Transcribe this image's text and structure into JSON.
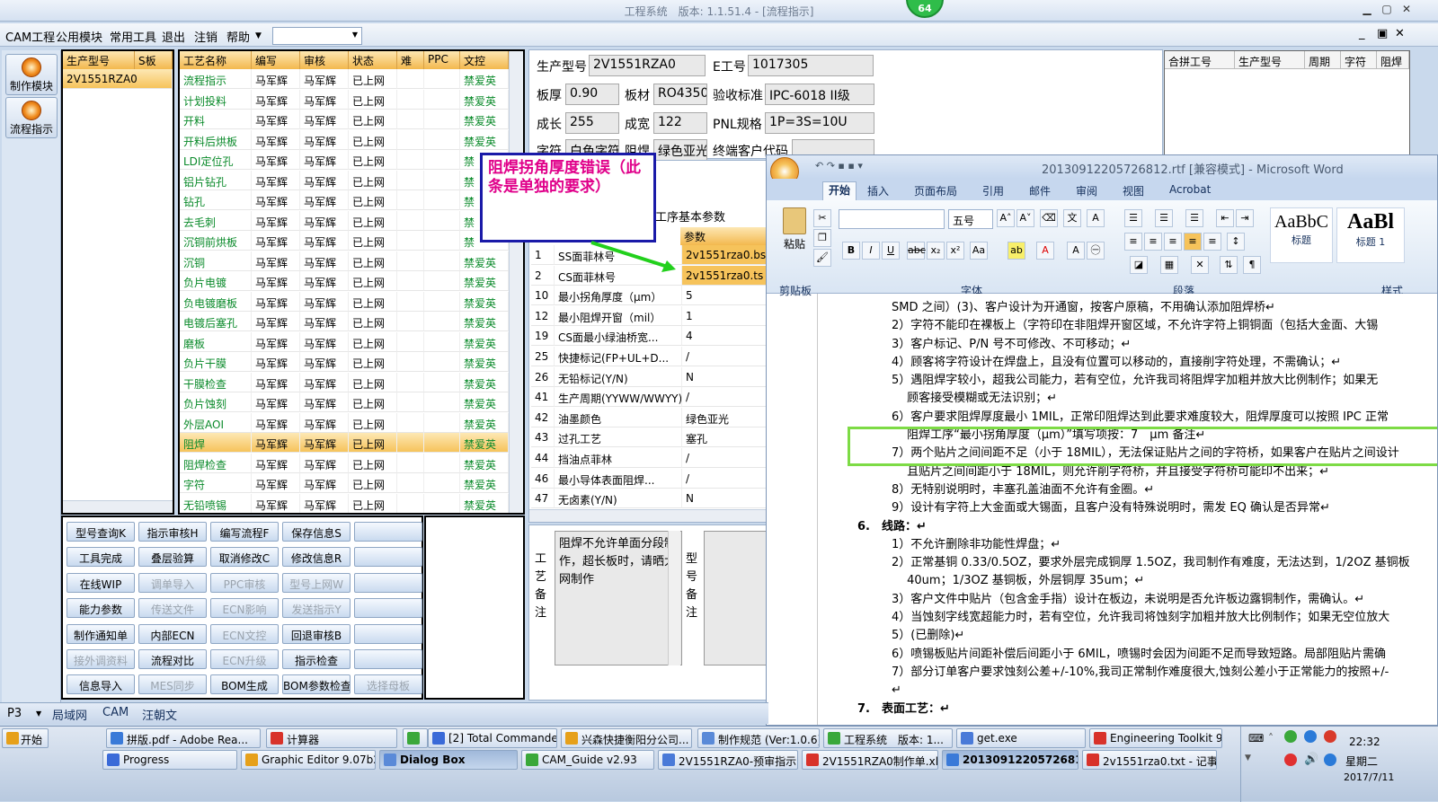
{
  "app": {
    "title": "工程系统　版本: 1.1.51.4 - [流程指示]",
    "badge": "64"
  },
  "menu": [
    "CAM工程",
    "公用模块",
    "常用工具",
    "退出",
    "注销",
    "帮助"
  ],
  "nav": [
    "制作模块",
    "流程指示"
  ],
  "model_list": {
    "headers": [
      "生产型号",
      "S板"
    ],
    "rows": [
      [
        "2V1551RZA0",
        ""
      ]
    ]
  },
  "process": {
    "headers": [
      "工艺名称",
      "编写",
      "审核",
      "状态",
      "难",
      "PPC",
      "文控"
    ],
    "rows": [
      [
        "流程指示",
        "马军辉",
        "马军辉",
        "已上网",
        "",
        "",
        "禁爱英"
      ],
      [
        "计划投料",
        "马军辉",
        "马军辉",
        "已上网",
        "",
        "",
        "禁爱英"
      ],
      [
        "开料",
        "马军辉",
        "马军辉",
        "已上网",
        "",
        "",
        "禁爱英"
      ],
      [
        "开料后烘板",
        "马军辉",
        "马军辉",
        "已上网",
        "",
        "",
        "禁爱英"
      ],
      [
        "LDI定位孔",
        "马军辉",
        "马军辉",
        "已上网",
        "",
        "",
        "禁"
      ],
      [
        "铝片钻孔",
        "马军辉",
        "马军辉",
        "已上网",
        "",
        "",
        "禁"
      ],
      [
        "钻孔",
        "马军辉",
        "马军辉",
        "已上网",
        "",
        "",
        "禁"
      ],
      [
        "去毛刺",
        "马军辉",
        "马军辉",
        "已上网",
        "",
        "",
        "禁"
      ],
      [
        "沉铜前烘板",
        "马军辉",
        "马军辉",
        "已上网",
        "",
        "",
        "禁"
      ],
      [
        "沉铜",
        "马军辉",
        "马军辉",
        "已上网",
        "",
        "",
        "禁爱英"
      ],
      [
        "负片电镀",
        "马军辉",
        "马军辉",
        "已上网",
        "",
        "",
        "禁爱英"
      ],
      [
        "负电镀磨板",
        "马军辉",
        "马军辉",
        "已上网",
        "",
        "",
        "禁爱英"
      ],
      [
        "电镀后塞孔",
        "马军辉",
        "马军辉",
        "已上网",
        "",
        "",
        "禁爱英"
      ],
      [
        "磨板",
        "马军辉",
        "马军辉",
        "已上网",
        "",
        "",
        "禁爱英"
      ],
      [
        "负片干膜",
        "马军辉",
        "马军辉",
        "已上网",
        "",
        "",
        "禁爱英"
      ],
      [
        "干膜检查",
        "马军辉",
        "马军辉",
        "已上网",
        "",
        "",
        "禁爱英"
      ],
      [
        "负片蚀刻",
        "马军辉",
        "马军辉",
        "已上网",
        "",
        "",
        "禁爱英"
      ],
      [
        "外层AOI",
        "马军辉",
        "马军辉",
        "已上网",
        "",
        "",
        "禁爱英"
      ],
      [
        "阻焊",
        "马军辉",
        "马军辉",
        "已上网",
        "",
        "",
        "禁爱英"
      ],
      [
        "阻焊检查",
        "马军辉",
        "马军辉",
        "已上网",
        "",
        "",
        "禁爱英"
      ],
      [
        "字符",
        "马军辉",
        "马军辉",
        "已上网",
        "",
        "",
        "禁爱英"
      ],
      [
        "无铅喷锡",
        "马军辉",
        "马军辉",
        "已上网",
        "",
        "",
        "禁爱英"
      ]
    ],
    "selected_index": 18
  },
  "buttons": [
    [
      "型号查询K",
      "指示审核H",
      "编写流程F",
      "保存信息S",
      ""
    ],
    [
      "工具完成",
      "叠层验算",
      "取消修改C",
      "修改信息R",
      ""
    ],
    [
      "在线WIP",
      "调单导入",
      "PPC审核",
      "型号上网W",
      ""
    ],
    [
      "能力参数",
      "传送文件",
      "ECN影响",
      "发送指示Y",
      ""
    ],
    [
      "制作通知单",
      "内部ECN",
      "ECN文控",
      "回退审核B",
      ""
    ],
    [
      "接外调资料",
      "流程对比",
      "ECN升级",
      "指示检查",
      ""
    ],
    [
      "信息导入",
      "MES同步",
      "BOM生成",
      "BOM参数检查",
      "选择母板"
    ]
  ],
  "disabled_buttons": [
    "调单导入",
    "PPC审核",
    "型号上网W",
    "传送文件",
    "ECN影响",
    "发送指示Y",
    "ECN文控",
    "接外调资料",
    "ECN升级",
    "MES同步",
    "选择母板"
  ],
  "info": {
    "lbl_model": "生产型号",
    "model": "2V1551RZA0",
    "lbl_e": "E工号",
    "e": "1017305",
    "lbl_thick": "板厚",
    "thick": "0.90",
    "lbl_mat": "板材",
    "mat": "RO4350B",
    "lbl_std": "验收标准",
    "std": "IPC-6018 II级",
    "lbl_len": "成长",
    "len": "255",
    "lbl_wid": "成宽",
    "wid": "122",
    "lbl_pnl": "PNL规格",
    "pnl": "1P=3S=10U",
    "lbl_char": "字符",
    "char": "白色字符",
    "lbl_sm": "阻焊",
    "sm": "绿色亚光",
    "lbl_end": "终端客户代码",
    "end": ""
  },
  "right_grid_headers": [
    "合拼工号",
    "生产型号",
    "周期",
    "字符",
    "阻焊"
  ],
  "params": {
    "tab": "工序基本参数",
    "col": "参数",
    "rows": [
      [
        "1",
        "SS面菲林号",
        "2v1551rza0.bs"
      ],
      [
        "2",
        "CS面菲林号",
        "2v1551rza0.ts"
      ],
      [
        "10",
        "最小拐角厚度（μm）",
        "5"
      ],
      [
        "12",
        "最小阻焊开窗（mil）",
        "1"
      ],
      [
        "19",
        "CS面最小绿油桥宽...",
        "4"
      ],
      [
        "25",
        "快捷标记(FP+UL+D...",
        "/"
      ],
      [
        "26",
        "无铅标记(Y/N)",
        "N"
      ],
      [
        "41",
        "生产周期(YYWW/WWYY)",
        "/"
      ],
      [
        "42",
        "油墨颜色",
        "绿色亚光"
      ],
      [
        "43",
        "过孔工艺",
        "塞孔"
      ],
      [
        "44",
        "挡油点菲林",
        "/"
      ],
      [
        "46",
        "最小导体表面阻焊...",
        "/"
      ],
      [
        "47",
        "无卤素(Y/N)",
        "N"
      ]
    ]
  },
  "remarks": {
    "label1": "工艺备注",
    "text": "阻焊不允许单面分段制作，超长板时，请晒大网制作",
    "label2": "型号备注"
  },
  "annotation": "阻焊拐角厚度错误（此条是单独的要求）",
  "word": {
    "title": "20130912205726812.rtf [兼容模式] - Microsoft Word",
    "tabs": [
      "开始",
      "插入",
      "页面布局",
      "引用",
      "邮件",
      "审阅",
      "视图",
      "Acrobat"
    ],
    "font_size": "五号",
    "groups": [
      "剪贴板",
      "字体",
      "段落",
      "样式"
    ],
    "paste": "粘贴",
    "styles": [
      {
        "sample": "AaBbC",
        "name": "标题"
      },
      {
        "sample": "AaBl",
        "name": "标题 1"
      }
    ],
    "lines": [
      "SMD 之间）(3)、客户设计为开通窗，按客户原稿，不用确认添加阻焊桥↵",
      "2）字符不能印在裸板上（字符印在非阻焊开窗区域，不允许字符上铜铜面（包括大金面、大锡",
      "3）客户标记、P/N 号不可修改、不可移动；↵",
      "4）顾客将字符设计在焊盘上，且没有位置可以移动的，直接削字符处理，不需确认；↵",
      "5）遇阻焊字较小，超我公司能力，若有空位，允许我司将阻焊字加粗并放大比例制作；如果无",
      "　 顾客接受模糊或无法识别；↵",
      "6）客户要求阻焊厚度最小 1MIL，正常印阻焊达到此要求难度较大，阻焊厚度可以按照 IPC 正常",
      "　 阻焊工序“最小拐角厚度（μm）”填写项按：7　μm 备注↵",
      "7）两个贴片之间间距不足（小于 18MIL），无法保证贴片之间的字符桥，如果客户在贴片之间设计",
      "　 且贴片之间间距小于 18MIL，则允许削字符桥，并且接受字符桥可能印不出来；↵",
      "8）无特别说明时，丰塞孔盖油面不允许有金圈。↵",
      "9）设计有字符上大金面或大锡面，且客户没有特殊说明时，需发 EQ 确认是否异常↵",
      "6.　线路：↵",
      "1）不允许删除非功能性焊盘；↵",
      "2）正常基铜 0.33/0.5OZ，要求外层完成铜厚 1.5OZ，我司制作有难度，无法达到，1/2OZ 基铜板",
      "　 40um；1/3OZ 基铜板，外层铜厚 35um；↵",
      "3）客户文件中贴片（包含金手指）设计在板边，未说明是否允许板边露铜制作，需确认。↵",
      "4）当蚀刻字线宽超能力时，若有空位，允许我司将蚀刻字加粗并放大比例制作；如果无空位放大",
      "5）(已删除)↵",
      "6）喷锡板贴片间距补偿后间距小于 6MIL，喷锡时会因为间距不足而导致短路。局部阻贴片需确",
      "7）部分订单客户要求蚀刻公差+/-10%,我司正常制作难度很大,蚀刻公差小于正常能力的按照+/-",
      "↵",
      "7.　表面工艺：↵"
    ]
  },
  "status": {
    "p": "P3",
    "items": [
      "局域网",
      "CAM",
      "汪朝文"
    ]
  },
  "taskbar": {
    "start": "开始",
    "row1": [
      "拼版.pdf - Adobe Rea...",
      "计算器",
      "",
      "[2] Total Commander ...",
      "兴森快捷衡阳分公司...",
      "制作规范 (Ver:1.0.6)",
      "工程系统　版本: 1...",
      "get.exe",
      "Engineering Toolkit 9...."
    ],
    "row2": [
      "Progress",
      "Graphic Editor 9.07b2 (0...",
      "Dialog Box",
      "CAM_Guide v2.93",
      "2V1551RZA0-预审指示...",
      "2V1551RZA0制作单.xls ...",
      "20130912205726812...",
      "2v1551rza0.txt - 记事本"
    ],
    "time": "22:32",
    "weekday": "星期二",
    "date": "2017/7/11"
  },
  "colors": {
    "accent": "#f3b84e",
    "green_text": "#0a8a2a",
    "annotation": "#e0008a",
    "annotation_border": "#1a1aa8",
    "highlight": "#7ddb45"
  }
}
